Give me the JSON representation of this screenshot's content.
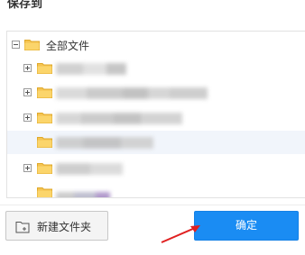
{
  "dialog": {
    "title": "保存到"
  },
  "tree": {
    "root": {
      "label": "全部文件",
      "expanded": true,
      "icon": "folder-icon"
    },
    "children": [
      {
        "expander": "plus",
        "icon": "folder-icon",
        "label_blurred": true
      },
      {
        "expander": "plus",
        "icon": "folder-icon",
        "label_blurred": true
      },
      {
        "expander": "plus",
        "icon": "folder-icon",
        "label_blurred": true
      },
      {
        "expander": "none",
        "icon": "folder-icon",
        "label_blurred": true,
        "selected": true
      },
      {
        "expander": "plus",
        "icon": "folder-icon",
        "label_blurred": true
      },
      {
        "expander": "none",
        "icon": "folder-icon",
        "label_blurred": true,
        "partially_visible": true
      }
    ]
  },
  "footer": {
    "new_folder_label": "新建文件夹",
    "confirm_label": "确定"
  },
  "colors": {
    "primary_button": "#1a8cf3",
    "folder": "#f5c451",
    "annotation_arrow": "#e02020",
    "selected_row": "#f1f5fb"
  }
}
